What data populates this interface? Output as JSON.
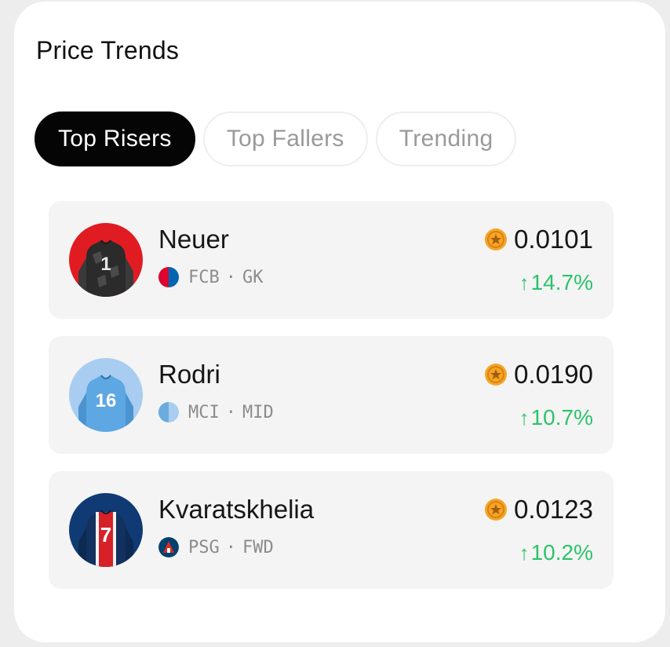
{
  "title": "Price Trends",
  "tabs": [
    {
      "label": "Top Risers",
      "active": true
    },
    {
      "label": "Top Fallers",
      "active": false
    },
    {
      "label": "Trending",
      "active": false
    }
  ],
  "players": [
    {
      "name": "Neuer",
      "club": "FCB",
      "position": "GK",
      "price": "0.0101",
      "change": "14.7%",
      "jersey_number": "1",
      "jersey_color": "#2f2f2f",
      "club_color": "#dc052d"
    },
    {
      "name": "Rodri",
      "club": "MCI",
      "position": "MID",
      "price": "0.0190",
      "change": "10.7%",
      "jersey_number": "16",
      "jersey_color": "#6cabdd",
      "club_color": "#6cabdd"
    },
    {
      "name": "Kvaratskhelia",
      "club": "PSG",
      "position": "FWD",
      "price": "0.0123",
      "change": "10.2%",
      "jersey_number": "7",
      "jersey_color": "#004170",
      "club_color": "#da291c"
    }
  ],
  "colors": {
    "accent_up": "#2cc36b",
    "coin": "#f5a623",
    "active_tab": "#050505"
  },
  "icons": {
    "coin": "star-coin-icon",
    "change": "arrow-up-icon",
    "separator": "·"
  }
}
